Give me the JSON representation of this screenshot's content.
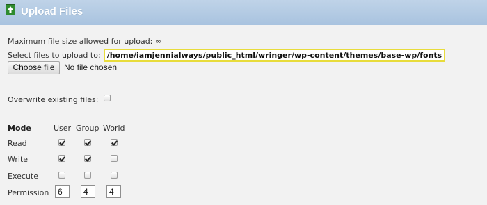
{
  "header": {
    "title": "Upload Files",
    "icon": "upload-arrow-icon"
  },
  "upload": {
    "max_size_label": "Maximum file size allowed for upload:",
    "max_size_value": "∞",
    "select_label": "Select files to upload to:",
    "path": "/home/iamjennialways/public_html/wringer/wp-content/themes/base-wp/fonts",
    "choose_button": "Choose file",
    "no_file": "No file chosen",
    "overwrite_label": "Overwrite existing files:",
    "overwrite_checked": false
  },
  "permissions": {
    "mode_label": "Mode",
    "columns": [
      "User",
      "Group",
      "World"
    ],
    "rows": [
      {
        "label": "Read",
        "values": [
          true,
          true,
          true
        ]
      },
      {
        "label": "Write",
        "values": [
          true,
          true,
          false
        ]
      },
      {
        "label": "Execute",
        "values": [
          false,
          false,
          false
        ]
      }
    ],
    "permission_label": "Permission",
    "permission_values": [
      "6",
      "4",
      "4"
    ]
  },
  "colors": {
    "header_bg": "#afc7e1",
    "path_highlight": "#e8dc3c"
  }
}
